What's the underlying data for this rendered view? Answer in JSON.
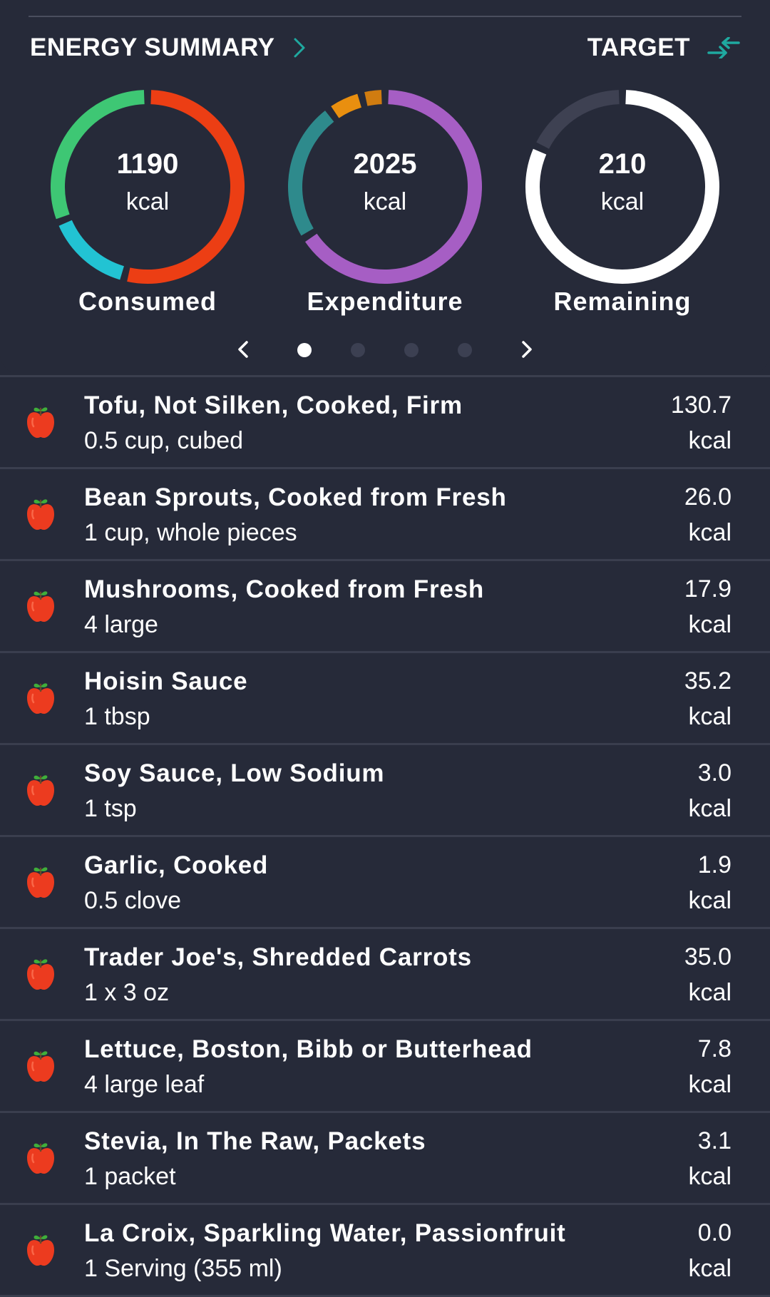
{
  "header": {
    "title": "ENERGY SUMMARY",
    "target_label": "TARGET",
    "icons": {
      "title_chevron": "chevron-right-icon",
      "target_toggle": "swap-arrows-icon"
    },
    "accent_color": "#1fa9a0"
  },
  "rings": [
    {
      "value": "1190",
      "unit": "kcal",
      "label": "Consumed",
      "segments": [
        {
          "name": "red",
          "color": "#ec3e14",
          "fraction": 0.54
        },
        {
          "name": "cyan",
          "color": "#22c3d3",
          "fraction": 0.15
        },
        {
          "name": "green",
          "color": "#3ec774",
          "fraction": 0.31
        }
      ]
    },
    {
      "value": "2025",
      "unit": "kcal",
      "label": "Expenditure",
      "segments": [
        {
          "name": "purple",
          "color": "#a65ec4",
          "fraction": 0.66
        },
        {
          "name": "teal",
          "color": "#2e8a8c",
          "fraction": 0.24
        },
        {
          "name": "orange",
          "color": "#e98f0f",
          "fraction": 0.06
        },
        {
          "name": "dark-orange",
          "color": "#d07c10",
          "fraction": 0.04
        }
      ]
    },
    {
      "value": "210",
      "unit": "kcal",
      "label": "Remaining",
      "segments": [
        {
          "name": "white",
          "color": "#ffffff",
          "fraction": 0.82
        },
        {
          "name": "gray",
          "color": "#3e4152",
          "fraction": 0.18
        }
      ]
    }
  ],
  "pager": {
    "pages": 4,
    "active": 0,
    "icons": {
      "prev": "chevron-left-icon",
      "next": "chevron-right-icon"
    }
  },
  "foods": [
    {
      "name": "Tofu, Not Silken, Cooked, Firm",
      "serving": "0.5 cup, cubed",
      "kcal": "130.7",
      "unit": "kcal",
      "icon": "apple-icon"
    },
    {
      "name": "Bean Sprouts, Cooked from Fresh",
      "serving": "1 cup, whole pieces",
      "kcal": "26.0",
      "unit": "kcal",
      "icon": "apple-icon"
    },
    {
      "name": "Mushrooms, Cooked from Fresh",
      "serving": "4 large",
      "kcal": "17.9",
      "unit": "kcal",
      "icon": "apple-icon"
    },
    {
      "name": "Hoisin Sauce",
      "serving": "1 tbsp",
      "kcal": "35.2",
      "unit": "kcal",
      "icon": "apple-icon"
    },
    {
      "name": "Soy Sauce, Low Sodium",
      "serving": "1 tsp",
      "kcal": "3.0",
      "unit": "kcal",
      "icon": "apple-icon"
    },
    {
      "name": "Garlic, Cooked",
      "serving": "0.5 clove",
      "kcal": "1.9",
      "unit": "kcal",
      "icon": "apple-icon"
    },
    {
      "name": "Trader Joe's, Shredded Carrots",
      "serving": "1 x 3 oz",
      "kcal": "35.0",
      "unit": "kcal",
      "icon": "apple-icon"
    },
    {
      "name": "Lettuce, Boston, Bibb or Butterhead",
      "serving": "4 large leaf",
      "kcal": "7.8",
      "unit": "kcal",
      "icon": "apple-icon"
    },
    {
      "name": "Stevia, In The Raw, Packets",
      "serving": "1 packet",
      "kcal": "3.1",
      "unit": "kcal",
      "icon": "apple-icon"
    },
    {
      "name": "La Croix, Sparkling Water, Passionfruit",
      "serving": "1 Serving (355 ml)",
      "kcal": "0.0",
      "unit": "kcal",
      "icon": "apple-icon"
    }
  ]
}
